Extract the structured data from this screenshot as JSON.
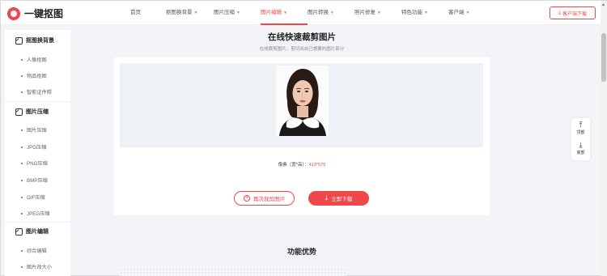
{
  "header": {
    "logo_text": "一键抠图",
    "nav": [
      {
        "label": "首页",
        "caret": false
      },
      {
        "label": "抠图换背景",
        "caret": true
      },
      {
        "label": "图片压缩",
        "caret": true
      },
      {
        "label": "图片编辑",
        "caret": true,
        "active": true
      },
      {
        "label": "图片转换",
        "caret": true
      },
      {
        "label": "照片修复",
        "caret": true
      },
      {
        "label": "特色功能",
        "caret": true
      },
      {
        "label": "客户端",
        "caret": true
      }
    ],
    "download_button": "客户端下载"
  },
  "sidebar": {
    "sections": [
      {
        "title": "抠图换背景",
        "items": [
          "人像抠图",
          "物品抠图",
          "智能证件照"
        ]
      },
      {
        "title": "图片压缩",
        "items": [
          "图片压缩",
          "JPG压缩",
          "PNG压缩",
          "BMP压缩",
          "GIF压缩",
          "JPEG压缩"
        ]
      },
      {
        "title": "图片编辑",
        "items": [
          "综合编辑",
          "图片改大小"
        ]
      }
    ]
  },
  "main": {
    "title": "在线快速裁剪图片",
    "subtitle": "在线裁剪图片，剪切出自己想要的图片部分",
    "pixel_label": "像素（宽*高）：",
    "pixel_value": "413*579",
    "recrop_button": "再次裁剪图片",
    "download_button": "立即下载",
    "section2_title": "功能优势"
  },
  "float_tools": {
    "top_label": "顶部",
    "bottom_label": "底部"
  },
  "colors": {
    "accent": "#f0474a",
    "background": "#f3f4f7",
    "preview_bg": "#eef1f6"
  }
}
